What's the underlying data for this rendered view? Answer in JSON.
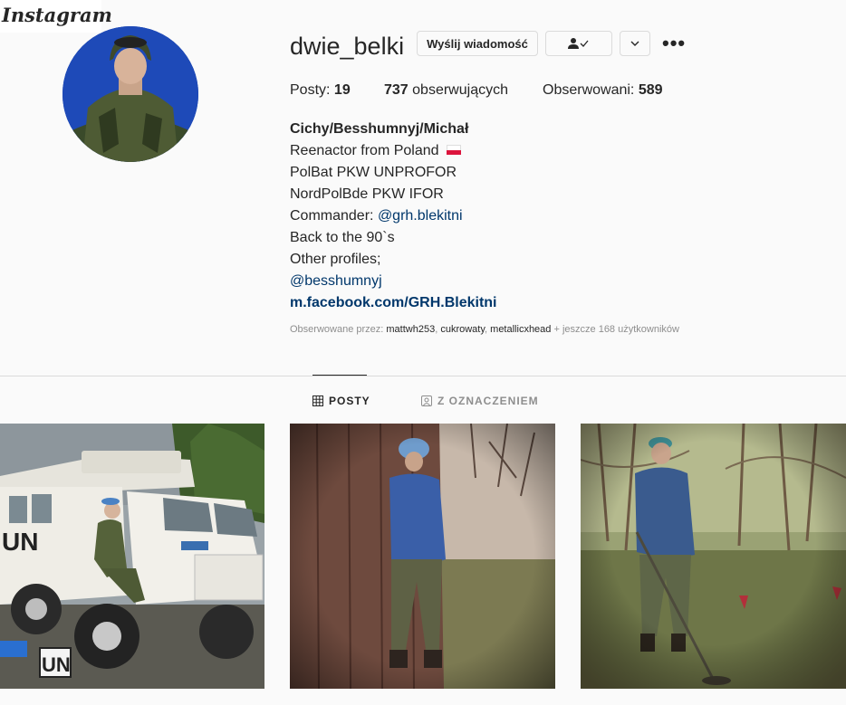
{
  "app": {
    "logo_text": "Instagram"
  },
  "profile": {
    "username": "dwie_belki",
    "message_button": "Wyślij wiadomość",
    "following_icon": "person-check-icon",
    "dropdown_icon": "chevron-down-icon",
    "more_icon": "more-options-icon",
    "more_label": "•••"
  },
  "stats": {
    "posts_label": "Posty:",
    "posts_count": "19",
    "followers_count": "737",
    "followers_label": "obserwujących",
    "following_label": "Obserwowani:",
    "following_count": "589"
  },
  "bio": {
    "name": "Cichy/Besshumnyj/Michał",
    "line1": "Reenactor from Poland",
    "line2": "PolBat PKW UNPROFOR",
    "line3": "NordPolBde PKW IFOR",
    "line4_prefix": "Commander:",
    "line4_link": "@grh.blekitni",
    "line5": "Back to the 90`s",
    "line6": "Other profiles;",
    "line7_link": "@besshumnyj",
    "website": "m.facebook.com/GRH.Blekitni"
  },
  "followed_by": {
    "prefix": "Obserwowane przez:",
    "users": [
      "mattwh253",
      "cukrowaty",
      "metallicxhead"
    ],
    "suffix": "+ jeszcze 168 użytkowników"
  },
  "tabs": [
    {
      "label": "POSTY",
      "icon": "grid-icon",
      "active": true
    },
    {
      "label": "Z OZNACZENIEM",
      "icon": "tagged-icon",
      "active": false
    }
  ],
  "posts": [
    {
      "description_icon": "photo",
      "overlay_text": "UN",
      "truck_text": "UN"
    },
    {
      "description_icon": "photo"
    },
    {
      "description_icon": "photo"
    }
  ],
  "colors": {
    "link": "#00376b",
    "text": "#262626",
    "muted": "#8e8e8e",
    "border": "#dbdbdb"
  }
}
